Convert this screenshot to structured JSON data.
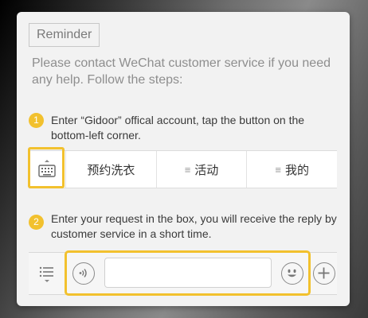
{
  "dialog": {
    "title": "Reminder",
    "intro": "Please contact WeChat customer service if you need any help. Follow the steps:",
    "step1": {
      "number": "1",
      "text": "Enter “Gidoor” offical account, tap the button on the bottom-left corner."
    },
    "menu": {
      "items": [
        {
          "label": "预约洗衣",
          "has_icon": false
        },
        {
          "label": "活动",
          "has_icon": true,
          "icon": "hamburger-icon"
        },
        {
          "label": "我的",
          "has_icon": true,
          "icon": "hamburger-icon"
        }
      ]
    },
    "step2": {
      "number": "2",
      "text": "Enter your request in the box, you will receive the reply by customer service in a short time."
    },
    "input_bar": {
      "message_value": "",
      "icons": [
        "list-menu-icon",
        "voice-icon",
        "emoji-icon",
        "plus-icon"
      ]
    }
  },
  "colors": {
    "accent": "#f2c12e",
    "dialog_bg": "#f2f2f2",
    "muted_text": "#8e8e8e"
  }
}
